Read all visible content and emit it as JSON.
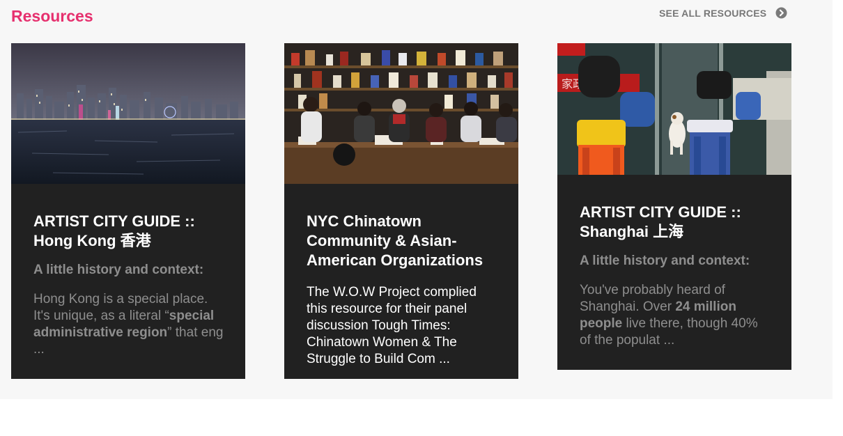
{
  "section": {
    "title": "Resources",
    "see_all_label": "SEE ALL RESOURCES",
    "see_all_icon": "arrow-right-circle-icon"
  },
  "colors": {
    "accent": "#e6306e",
    "card_bg": "#212121",
    "muted_text": "#8e8e8e",
    "section_bg": "#f7f7f7"
  },
  "cards": [
    {
      "title_line1": "ARTIST CITY GUIDE ::",
      "title_line2": "Hong Kong 香港",
      "subtitle": "A little history and context:",
      "excerpt_a": "Hong Kong is a special place. It's unique, as a literal “",
      "excerpt_bold": "special administrative region",
      "excerpt_b": "” that eng ...",
      "image": "hong-kong-harbor-night-skyline"
    },
    {
      "title_line1": "NYC Chinatown",
      "title_line2": "Community & Asian-",
      "title_line3": "American Organizations",
      "excerpt": "The W.O.W Project complied this resource for their panel discussion Tough Times: Chinatown Women & The Struggle to Build Com ...",
      "image": "panel-of-women-in-chinatown-shop"
    },
    {
      "title_line1": "ARTIST CITY GUIDE ::",
      "title_line2": "Shanghai 上海",
      "subtitle": "A little history and context:",
      "excerpt_a": "You've probably heard of Shanghai. Over ",
      "excerpt_bold": "24 million people",
      "excerpt_b": " live there, though 40% of the populat ...",
      "image": "shanghai-street-scene-with-dog",
      "image_sign_text": "家政服务"
    }
  ]
}
